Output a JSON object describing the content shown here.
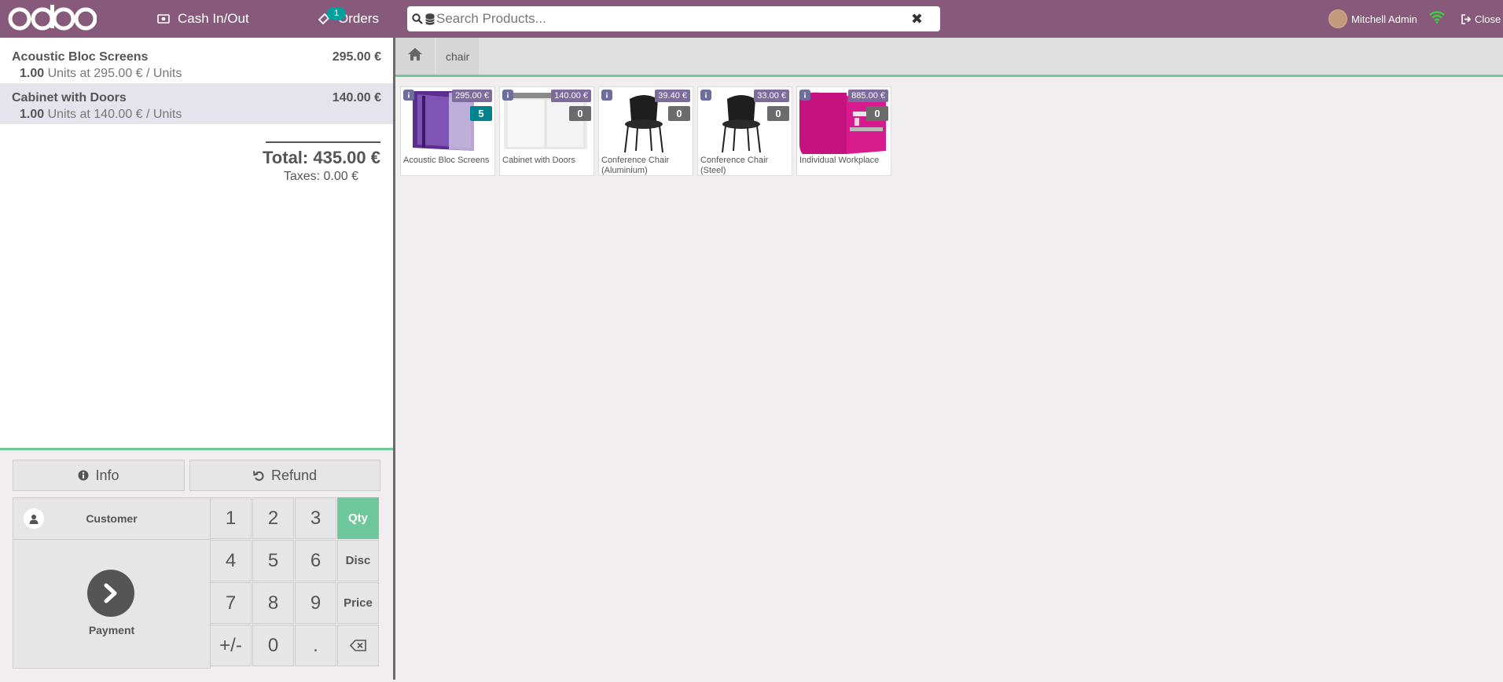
{
  "header": {
    "logo_text": "odoo",
    "cash_label": "Cash In/Out",
    "orders_label": "Orders",
    "orders_count": "1",
    "search_placeholder": "Search Products...",
    "user_name": "Mitchell Admin",
    "close_label": "Close",
    "icons": [
      "money-icon",
      "ticket-icon",
      "search-icon",
      "database-icon",
      "close-x-icon",
      "wifi-icon",
      "sign-out-icon"
    ]
  },
  "order": {
    "lines": [
      {
        "name": "Acoustic Bloc Screens",
        "price": "295.00 €",
        "qty": "1.00",
        "unit_text": "Units at 295.00 € / Units",
        "selected": false
      },
      {
        "name": "Cabinet with Doors",
        "price": "140.00 €",
        "qty": "1.00",
        "unit_text": "Units at 140.00 € / Units",
        "selected": true
      }
    ],
    "total": "Total: 435.00 €",
    "taxes": "Taxes: 0.00 €"
  },
  "controls": {
    "info_label": "Info",
    "refund_label": "Refund",
    "customer_label": "Customer",
    "payment_label": "Payment",
    "numpad": {
      "keys": [
        "1",
        "2",
        "3",
        "Qty",
        "4",
        "5",
        "6",
        "Disc",
        "7",
        "8",
        "9",
        "Price",
        "+/-",
        "0",
        ".",
        "⌫"
      ],
      "active_mode": "Qty"
    }
  },
  "breadcrumbs": {
    "items": [
      "chair"
    ]
  },
  "products": [
    {
      "name": "Acoustic Bloc Screens",
      "price": "295.00 €",
      "qty": "5"
    },
    {
      "name": "Cabinet with Doors",
      "price": "140.00 €",
      "qty": "0"
    },
    {
      "name": "Conference Chair (Aluminium)",
      "price": "39.40 €",
      "qty": "0"
    },
    {
      "name": "Conference Chair (Steel)",
      "price": "33.00 €",
      "qty": "0"
    },
    {
      "name": "Individual Workplace",
      "price": "885.00 €",
      "qty": "0"
    }
  ],
  "colors": {
    "brand": "#875a7b",
    "accent_green": "#6ec89b",
    "qty_badge_positive": "#01838f",
    "price_badge": "#7d6b9e"
  }
}
